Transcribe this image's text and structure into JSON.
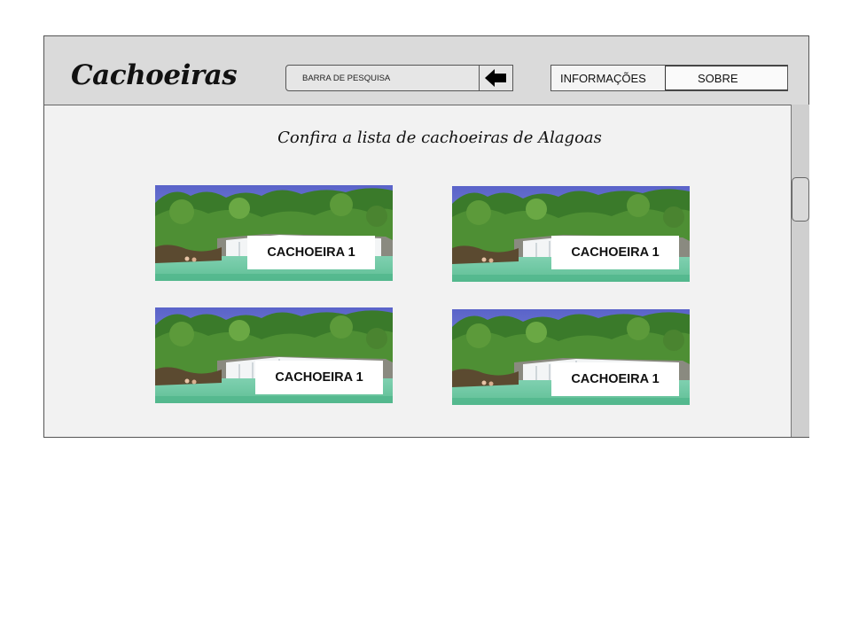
{
  "header": {
    "logo": "Cachoeiras",
    "search": {
      "label": "BARRA DE PESQUISA",
      "button_icon": "arrow-left-icon"
    },
    "nav": {
      "info": "INFORMAÇÕES",
      "sobre": "SOBRE"
    }
  },
  "main": {
    "title": "Confira a lista de cachoeiras de Alagoas",
    "cards": [
      {
        "label": "CACHOEIRA 1"
      },
      {
        "label": "CACHOEIRA 1"
      },
      {
        "label": "CACHOEIRA 1"
      },
      {
        "label": "CACHOEIRA 1"
      }
    ]
  },
  "colors": {
    "sky": "#5a63c9",
    "forest": "#3a7a2a",
    "water": "#5fbf95",
    "header_bg": "#dadada",
    "content_bg": "#f2f2f2"
  }
}
